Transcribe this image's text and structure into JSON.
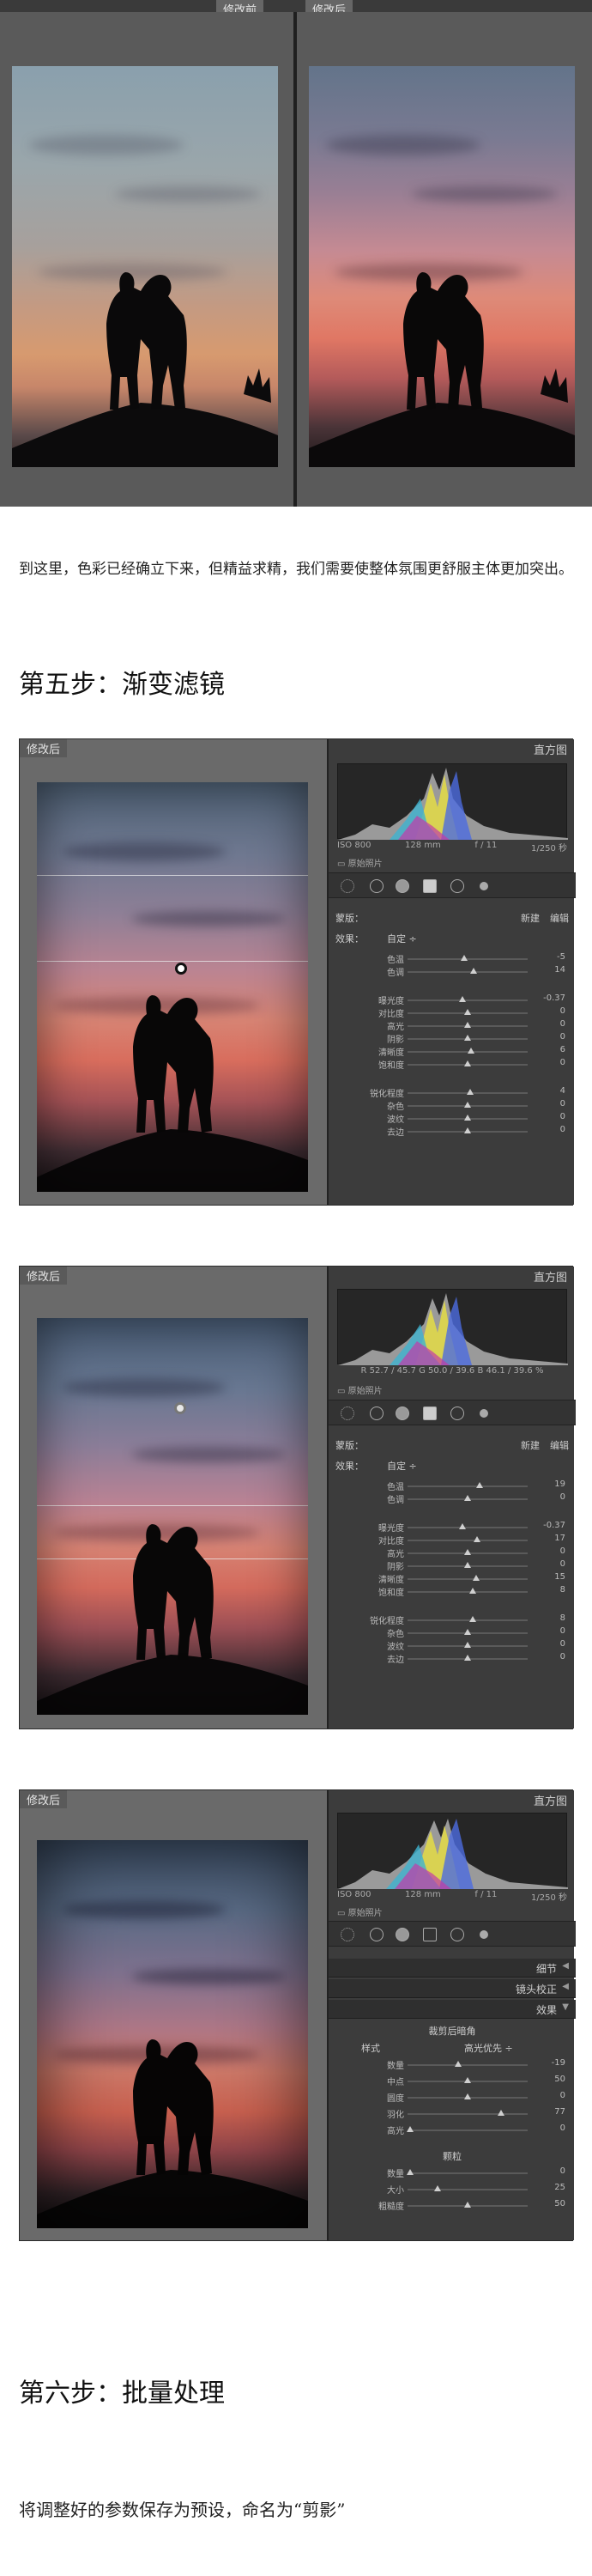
{
  "compare": {
    "before_tag": "修改前",
    "after_tag": "修改后"
  },
  "paragraph1": "到这里，色彩已经确立下来，但精益求精，我们需要使整体氛围更舒服主体更加突出。",
  "step5_title": "第五步：渐变滤镜",
  "lr1": {
    "view_tag": "修改后",
    "histogram_title": "直方图",
    "hist_info": [
      "ISO 800",
      "128 mm",
      "f / 11",
      "1/250 秒"
    ],
    "original_photo": "原始照片",
    "mask_label": "蒙版：",
    "mask_new": "新建",
    "mask_edit": "编辑",
    "effect_label": "效果：",
    "effect_value": "自定 ÷",
    "sliders": [
      {
        "label": "色温",
        "value": "-5",
        "pos": 0.47
      },
      {
        "label": "色调",
        "value": "14",
        "pos": 0.55
      },
      {
        "label": "曝光度",
        "value": "-0.37",
        "pos": 0.46
      },
      {
        "label": "对比度",
        "value": "0",
        "pos": 0.5
      },
      {
        "label": "高光",
        "value": "0",
        "pos": 0.5
      },
      {
        "label": "阴影",
        "value": "0",
        "pos": 0.5
      },
      {
        "label": "清晰度",
        "value": "6",
        "pos": 0.53
      },
      {
        "label": "饱和度",
        "value": "0",
        "pos": 0.5
      },
      {
        "label": "锐化程度",
        "value": "4",
        "pos": 0.52
      },
      {
        "label": "杂色",
        "value": "0",
        "pos": 0.5
      },
      {
        "label": "波纹",
        "value": "0",
        "pos": 0.5
      },
      {
        "label": "去边",
        "value": "0",
        "pos": 0.5
      }
    ]
  },
  "lr2": {
    "view_tag": "修改后",
    "histogram_title": "直方图",
    "rgb_readout": "R 52.7 / 45.7   G 50.0 / 39.6   B 46.1 / 39.6 %",
    "original_photo": "原始照片",
    "mask_label": "蒙版：",
    "mask_new": "新建",
    "mask_edit": "编辑",
    "effect_label": "效果：",
    "effect_value": "自定 ÷",
    "sliders": [
      {
        "label": "色温",
        "value": "19",
        "pos": 0.6
      },
      {
        "label": "色调",
        "value": "0",
        "pos": 0.5
      },
      {
        "label": "曝光度",
        "value": "-0.37",
        "pos": 0.46
      },
      {
        "label": "对比度",
        "value": "17",
        "pos": 0.58
      },
      {
        "label": "高光",
        "value": "0",
        "pos": 0.5
      },
      {
        "label": "阴影",
        "value": "0",
        "pos": 0.5
      },
      {
        "label": "清晰度",
        "value": "15",
        "pos": 0.57
      },
      {
        "label": "饱和度",
        "value": "8",
        "pos": 0.54
      },
      {
        "label": "锐化程度",
        "value": "8",
        "pos": 0.54
      },
      {
        "label": "杂色",
        "value": "0",
        "pos": 0.5
      },
      {
        "label": "波纹",
        "value": "0",
        "pos": 0.5
      },
      {
        "label": "去边",
        "value": "0",
        "pos": 0.5
      }
    ]
  },
  "lr3": {
    "view_tag": "修改后",
    "histogram_title": "直方图",
    "hist_info": [
      "ISO 800",
      "128 mm",
      "f / 11",
      "1/250 秒"
    ],
    "original_photo": "原始照片",
    "panels": [
      "细节",
      "镜头校正",
      "效果"
    ],
    "vignette_title": "裁剪后暗角",
    "style_label": "样式",
    "style_value": "高光优先 ÷",
    "sliders": [
      {
        "label": "数量",
        "value": "-19",
        "pos": 0.42
      },
      {
        "label": "中点",
        "value": "50",
        "pos": 0.5
      },
      {
        "label": "圆度",
        "value": "0",
        "pos": 0.5
      },
      {
        "label": "羽化",
        "value": "77",
        "pos": 0.78
      },
      {
        "label": "高光",
        "value": "0",
        "pos": 0.02
      }
    ],
    "grain_title": "颗粒",
    "grain_sliders": [
      {
        "label": "数量",
        "value": "0",
        "pos": 0.02
      },
      {
        "label": "大小",
        "value": "25",
        "pos": 0.25
      },
      {
        "label": "粗糙度",
        "value": "50",
        "pos": 0.5
      }
    ]
  },
  "step6_title": "第六步：批量处理",
  "paragraph2": "将调整好的参数保存为预设，命名为“剪影”"
}
